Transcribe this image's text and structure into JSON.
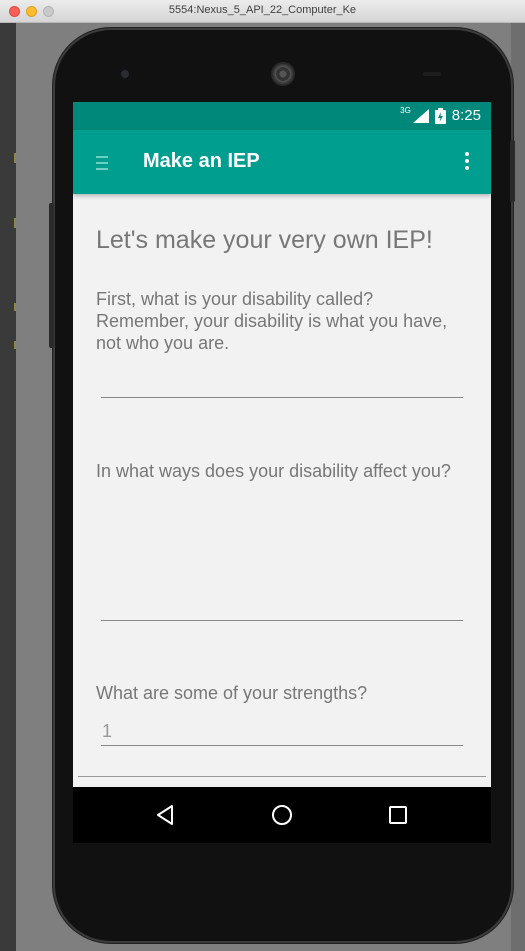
{
  "window": {
    "title": "5554:Nexus_5_API_22_Computer_Ke"
  },
  "status_bar": {
    "network": "3G",
    "time": "8:25"
  },
  "app_bar": {
    "title": "Make an IEP",
    "menu_icon": "hamburger-icon",
    "overflow_icon": "more-vert-icon"
  },
  "form": {
    "heading": "Let's make your very own IEP!",
    "q1": {
      "text": "First, what is your disability called? Remember, your disability is what you have, not who you are.",
      "value": ""
    },
    "q2": {
      "text": "In what ways does your disability affect you?",
      "value": ""
    },
    "q3": {
      "text": "What are some of your strengths?",
      "value": "1"
    }
  },
  "nav_bar": {
    "back": "back-icon",
    "home": "home-icon",
    "recents": "recents-icon"
  },
  "colors": {
    "status_bar": "#00897b",
    "app_bar": "#009e8f",
    "background": "#f2f2f2"
  }
}
